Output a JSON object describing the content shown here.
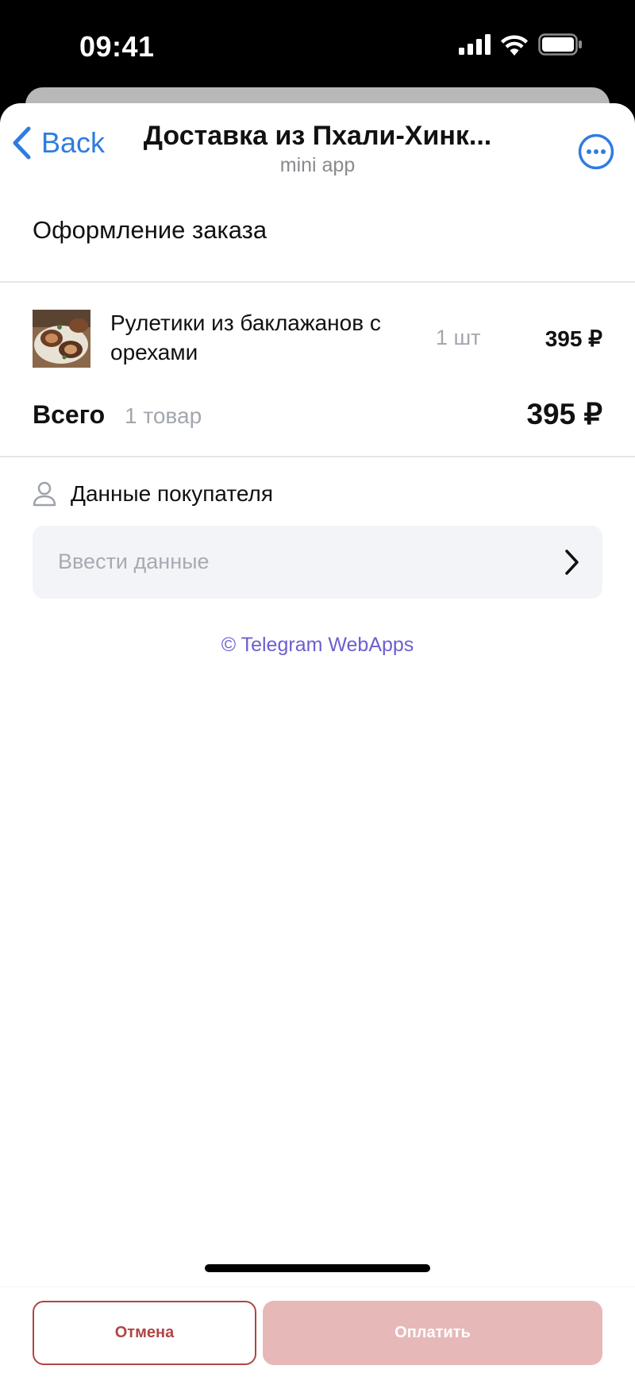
{
  "status_bar": {
    "time": "09:41",
    "icons": [
      "cellular-signal-icon",
      "wifi-icon",
      "battery-icon"
    ]
  },
  "nav": {
    "back_label": "Back",
    "title": "Доставка из Пхали-Хинк...",
    "subtitle": "mini app",
    "more_icon": "more-dots-icon"
  },
  "page": {
    "heading": "Оформление заказа"
  },
  "order": {
    "items": [
      {
        "name": "Рулетики из баклажанов с орехами",
        "quantity": "1 шт",
        "price": "395 ₽",
        "image": "eggplant-rolls-photo"
      }
    ],
    "total_label": "Всего",
    "total_count": "1 товар",
    "total_price": "395 ₽"
  },
  "buyer": {
    "label": "Данные покупателя",
    "icon": "user-icon",
    "placeholder": "Ввести данные"
  },
  "footer": {
    "credit": "© Telegram WebApps"
  },
  "actions": {
    "cancel_label": "Отмена",
    "pay_label": "Оплатить"
  },
  "colors": {
    "accent_blue": "#2f7ce0",
    "cancel_red": "#b04545",
    "pay_disabled": "#e6b9b8",
    "credit_purple": "#6a5fd0"
  }
}
